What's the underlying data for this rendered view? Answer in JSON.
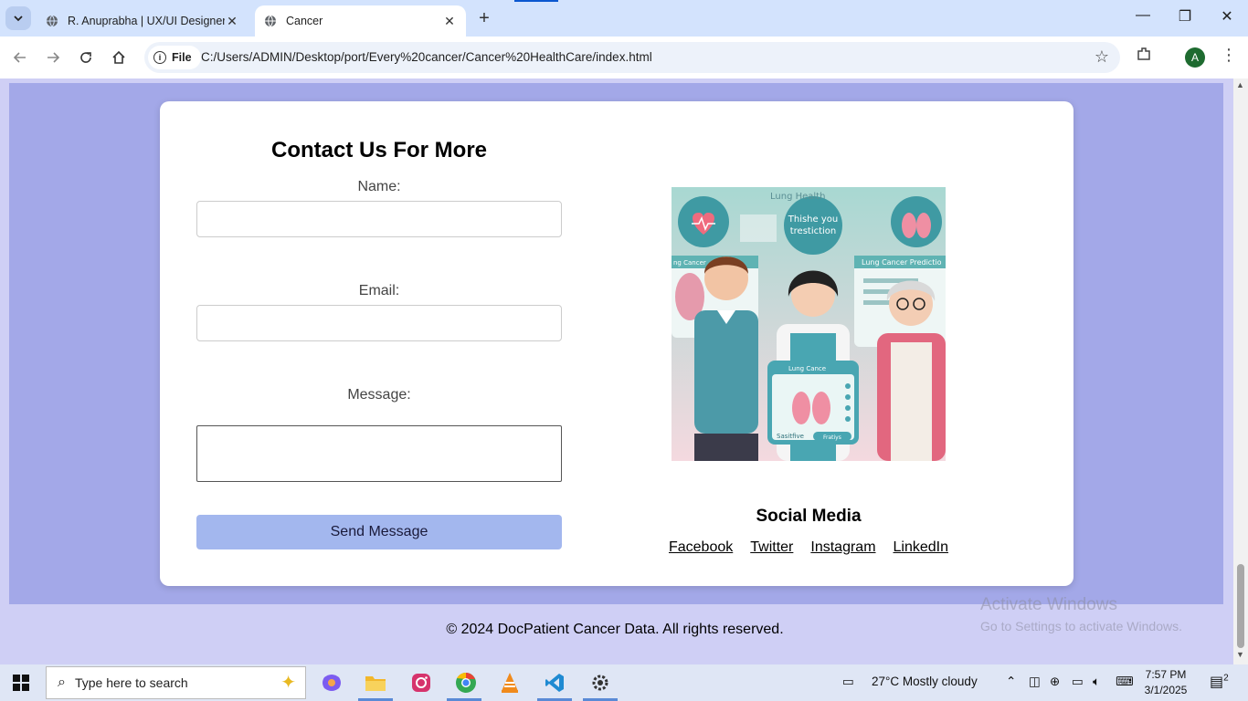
{
  "browser": {
    "tabs": [
      {
        "title": "R. Anuprabha | UX/UI Designer",
        "active": false
      },
      {
        "title": "Cancer",
        "active": true
      }
    ],
    "url_chip": "File",
    "url": "C:/Users/ADMIN/Desktop/port/Every%20cancer/Cancer%20HealthCare/index.html",
    "profile_initial": "A"
  },
  "contact": {
    "title": "Contact Us For More",
    "name_label": "Name:",
    "email_label": "Email:",
    "message_label": "Message:",
    "send_label": "Send Message"
  },
  "illustration": {
    "top_label": "Lung Health",
    "bubble_text_1": "Thishe you",
    "bubble_text_2": "trestiction",
    "left_panel": "ng Cancer",
    "right_panel": "Lung Cancer Predictio",
    "tablet_header": "Lung Cance",
    "tablet_left": "Sasitfive",
    "tablet_right": "Fratiys"
  },
  "social": {
    "title": "Social Media",
    "links": [
      "Facebook",
      "Twitter",
      "Instagram",
      "LinkedIn"
    ]
  },
  "footer": {
    "text": "© 2024 DocPatient Cancer Data. All rights reserved."
  },
  "watermark": {
    "line1": "Activate Windows",
    "line2": "Go to Settings to activate Windows."
  },
  "taskbar": {
    "search_placeholder": "Type here to search",
    "weather": "27°C  Mostly cloudy",
    "time": "7:57 PM",
    "date": "3/1/2025",
    "notification_count": "2"
  },
  "colors": {
    "section_bg": "#a3a8e8",
    "page_bg": "#cfcff5",
    "button_bg": "#a3b7ee"
  }
}
